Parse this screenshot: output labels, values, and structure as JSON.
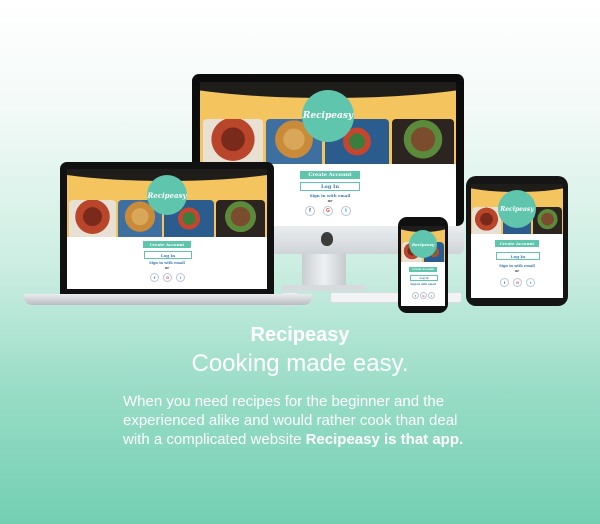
{
  "app": {
    "logo": "Recipeasy",
    "create_account": "Create Account",
    "log_in": "Log In",
    "sign_in_email": "Sign in with email",
    "or": "or",
    "social_icons": [
      "facebook-icon",
      "google-icon",
      "twitter-icon"
    ],
    "social_glyphs": [
      "f",
      "G",
      "t"
    ]
  },
  "headline": {
    "title": "Recipeasy",
    "subtitle": "Cooking made easy.",
    "description": "When you need recipes for the beginner and the experienced alike and would rather cook than deal with a complicated website",
    "description_bold": "Recipeasy is that app."
  },
  "colors": {
    "accent": "#5fc5ad",
    "hero_yellow": "#f4c45f",
    "link_blue": "#3a78b5",
    "background_bottom": "#73cfb2"
  }
}
